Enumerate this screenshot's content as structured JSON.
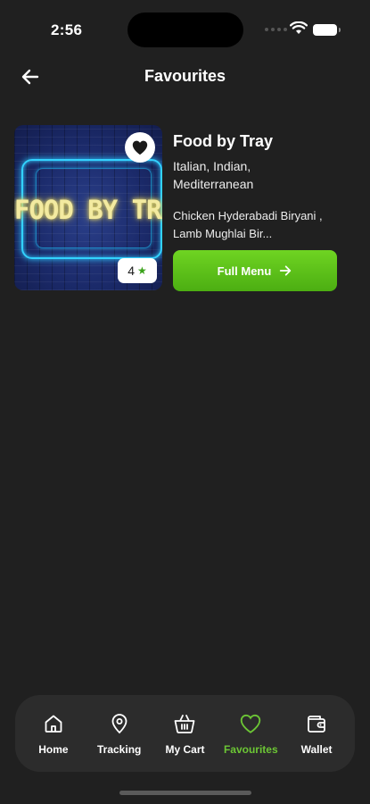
{
  "status_bar": {
    "time": "2:56"
  },
  "header": {
    "title": "Favourites",
    "back_icon": "arrow-left-icon"
  },
  "restaurant": {
    "name": "Food by Tray",
    "cuisine": "Italian, Indian, Mediterranean",
    "dishes": "Chicken Hyderabadi Biryani , Lamb Mughlai Bir...",
    "rating": "4",
    "image_text": "FOOD BY TRAY",
    "menu_button": "Full Menu",
    "favourited": true
  },
  "bottom_nav": {
    "active": "Favourites",
    "active_color": "#6cc635",
    "items": [
      {
        "label": "Home",
        "icon": "home-icon"
      },
      {
        "label": "Tracking",
        "icon": "location-pin-icon"
      },
      {
        "label": "My Cart",
        "icon": "basket-icon"
      },
      {
        "label": "Favourites",
        "icon": "heart-icon"
      },
      {
        "label": "Wallet",
        "icon": "wallet-icon"
      }
    ]
  },
  "colors": {
    "background": "#202020",
    "accent": "#5cc11a",
    "nav_bg": "#2c2c2c"
  }
}
